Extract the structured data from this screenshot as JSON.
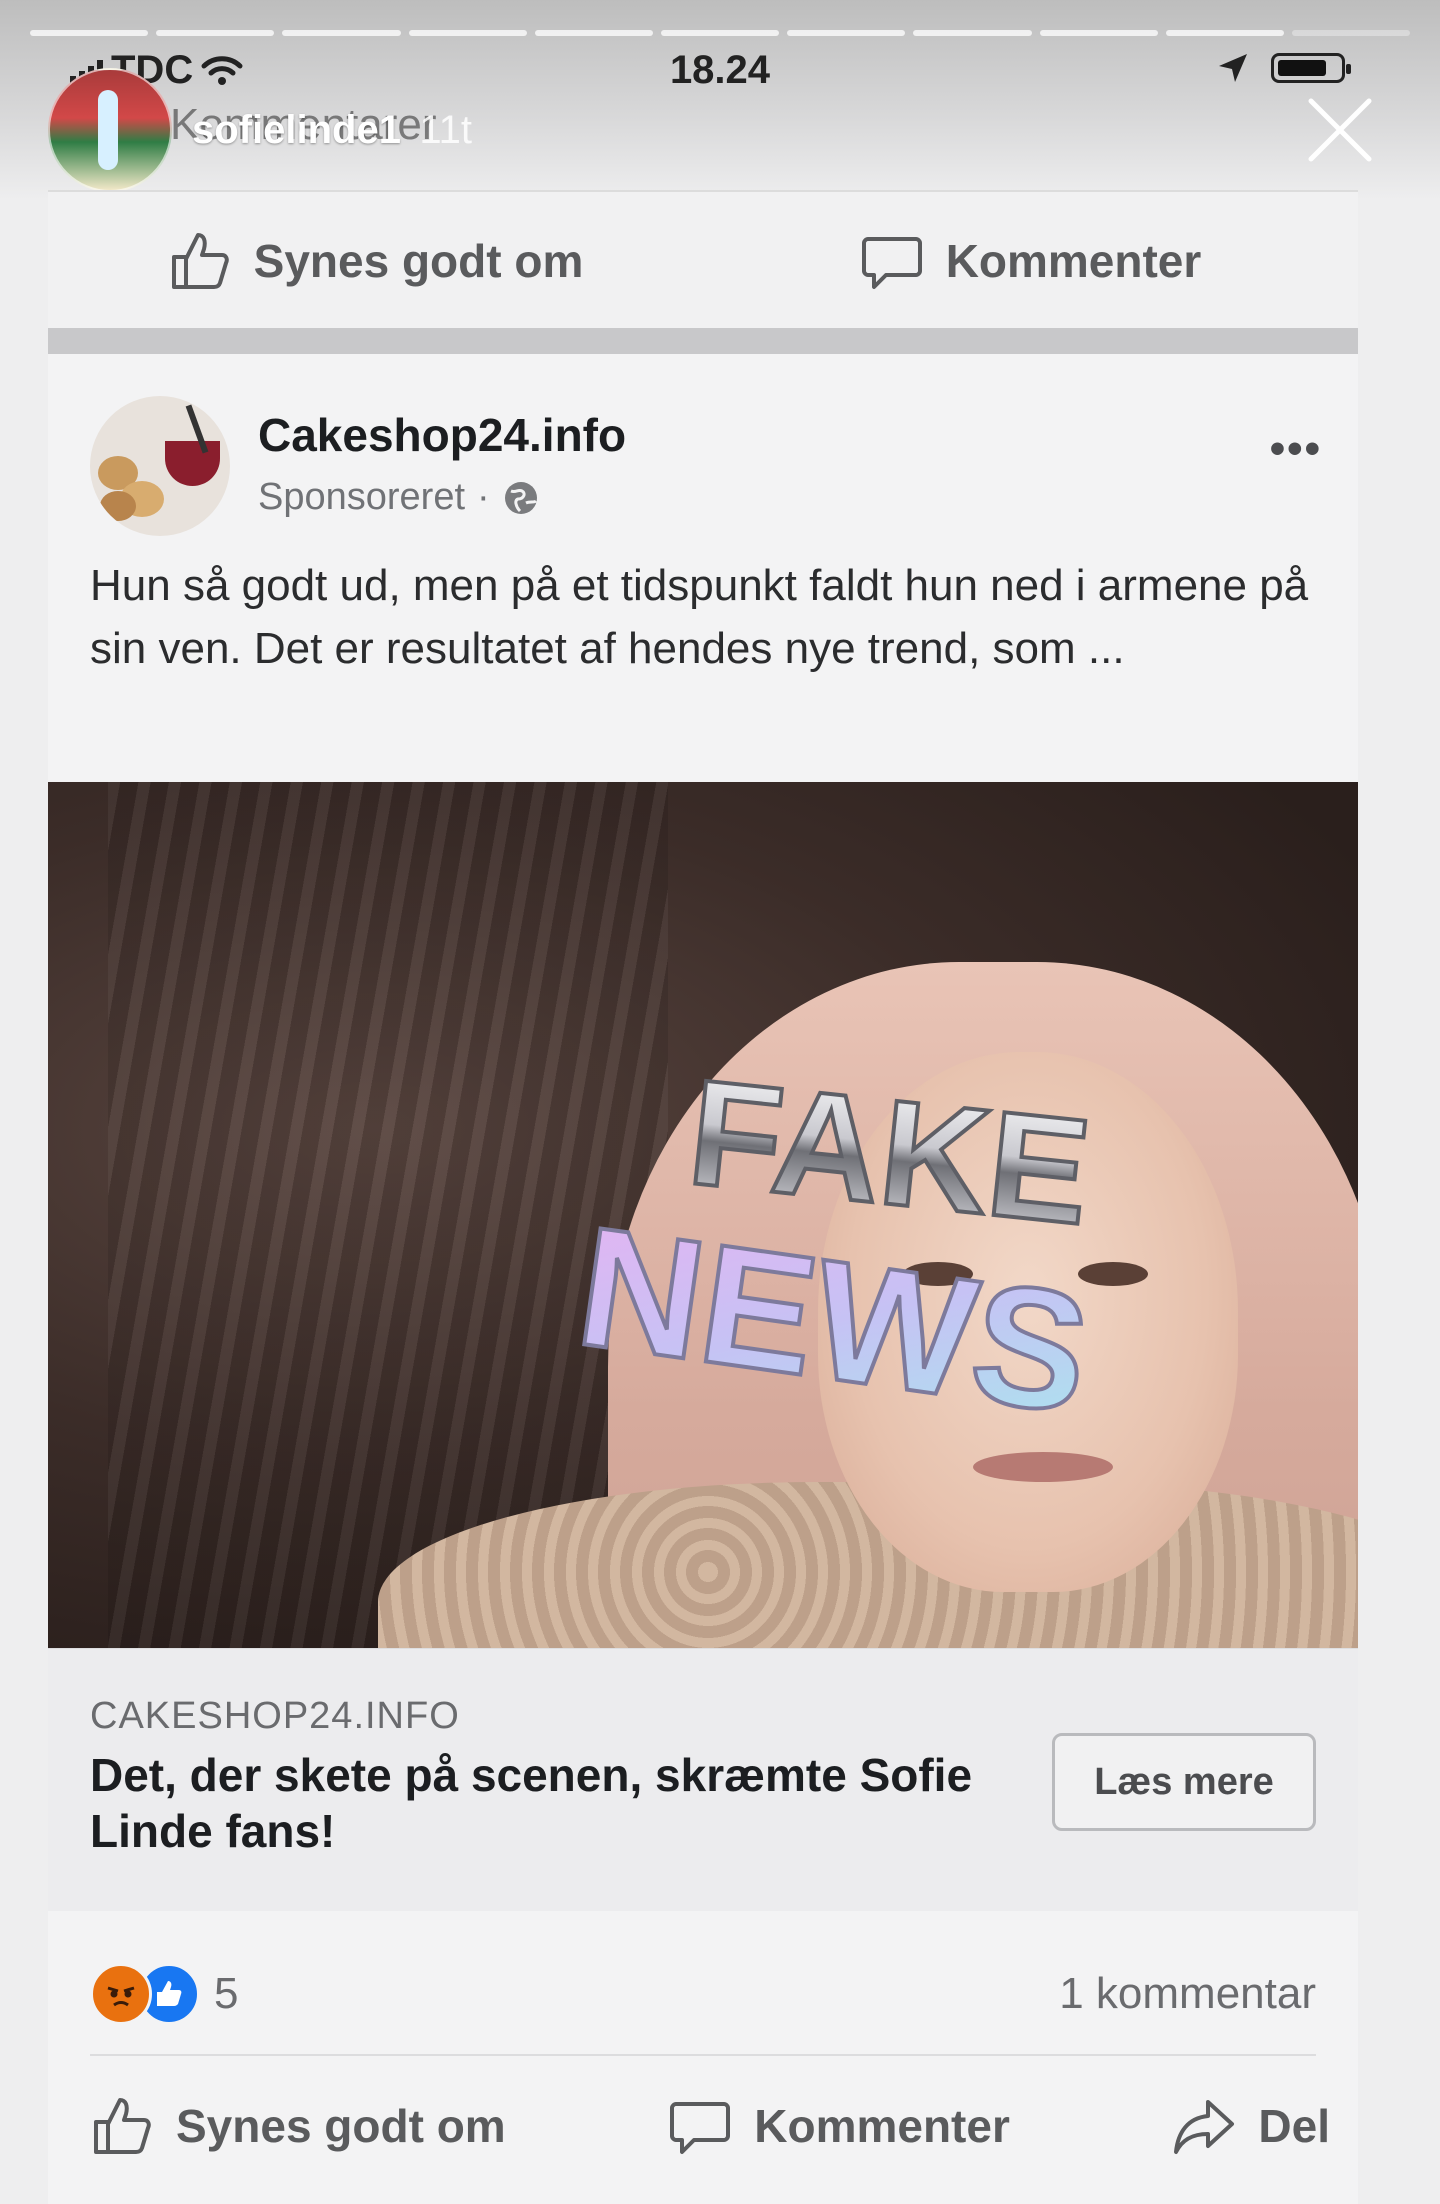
{
  "status_bar": {
    "carrier": "TDC",
    "time": "18.24"
  },
  "story": {
    "username": "sofielinde1",
    "age": "11t",
    "progress_segments": 11,
    "progress_active": 10
  },
  "background_text": "Kommentarer",
  "top_actions": {
    "like": "Synes godt om",
    "comment": "Kommenter"
  },
  "post": {
    "page_name": "Cakeshop24.info",
    "sponsored": "Sponsoreret",
    "more": "•••",
    "text": "Hun så godt ud, men på et tidspunkt faldt hun ned i armene på sin ven. Det er resultatet af hendes nye trend, som ...",
    "sticker": {
      "line1": "FAKE",
      "line2": "NEWS"
    },
    "link": {
      "domain": "CAKESHOP24.INFO",
      "headline": "Det, der skete på scenen, skræmte Sofie Linde fans!",
      "button": "Læs mere"
    },
    "reactions_count": "5",
    "comments_count": "1 kommentar",
    "actions": {
      "like": "Synes godt om",
      "comment": "Kommenter",
      "share": "Del"
    }
  },
  "colors": {
    "like_blue": "#1877f2",
    "angry_orange": "#e9710f"
  }
}
